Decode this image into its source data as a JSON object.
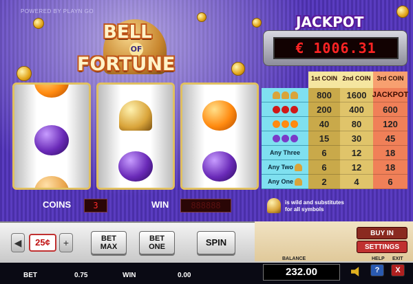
{
  "header": {
    "powered_by": "POWERED BY PLAYN GO"
  },
  "logo": {
    "word1": "BELL",
    "word2": "OF",
    "word3": "FORTUNE"
  },
  "jackpot": {
    "title": "JACKPOT",
    "amount": "€ 1006.31"
  },
  "reels": [
    [
      "orange",
      "plum",
      "peach"
    ],
    [
      "bell",
      "plum"
    ],
    [
      "orange",
      "plum"
    ]
  ],
  "paytable": {
    "headers": [
      "1st COIN",
      "2nd COIN",
      "3rd COIN"
    ],
    "col3_extra": "JACKPOT",
    "rows": [
      {
        "label": "",
        "icons": [
          "bell",
          "bell",
          "bell"
        ],
        "values": [
          "800",
          "1600",
          ""
        ]
      },
      {
        "label": "",
        "icons": [
          "cherry",
          "cherry",
          "cherry"
        ],
        "values": [
          "200",
          "400",
          "600"
        ]
      },
      {
        "label": "",
        "icons": [
          "orange",
          "orange",
          "orange"
        ],
        "values": [
          "40",
          "80",
          "120"
        ]
      },
      {
        "label": "",
        "icons": [
          "plum",
          "plum",
          "plum"
        ],
        "values": [
          "15",
          "30",
          "45"
        ]
      },
      {
        "label": "Any Three",
        "icons": [],
        "values": [
          "6",
          "12",
          "18"
        ]
      },
      {
        "label": "Any Two",
        "icons": [
          "bell"
        ],
        "values": [
          "6",
          "12",
          "18"
        ]
      },
      {
        "label": "Any One",
        "icons": [
          "bell"
        ],
        "values": [
          "2",
          "4",
          "6"
        ]
      }
    ]
  },
  "counters": {
    "coins_label": "COINS",
    "coins_value": "3",
    "win_label": "WIN",
    "win_value": "888888"
  },
  "wild_note": {
    "line1": "is wild and substitutes",
    "line2": "for all symbols"
  },
  "controls": {
    "coin_value": "25¢",
    "minus": "◀",
    "plus": "+",
    "bet_max": "BET MAX",
    "bet_one": "BET ONE",
    "spin": "SPIN",
    "buy_in": "BUY IN",
    "settings": "SETTINGS",
    "help": "HELP",
    "exit": "EXIT",
    "help_icon": "?",
    "exit_icon": "X"
  },
  "status": {
    "bet_label": "BET",
    "bet_value": "0.75",
    "win_label": "WIN",
    "win_value": "0.00",
    "balance_label": "BALANCE",
    "balance_value": "232.00"
  },
  "colors": {
    "background": "#4a2fa8",
    "jackpot_led": "#ff2424",
    "buy_in_button": "#8a2a20",
    "settings_button": "#c03030",
    "help_button": "#2a5ab0",
    "exit_button": "#b02020"
  }
}
